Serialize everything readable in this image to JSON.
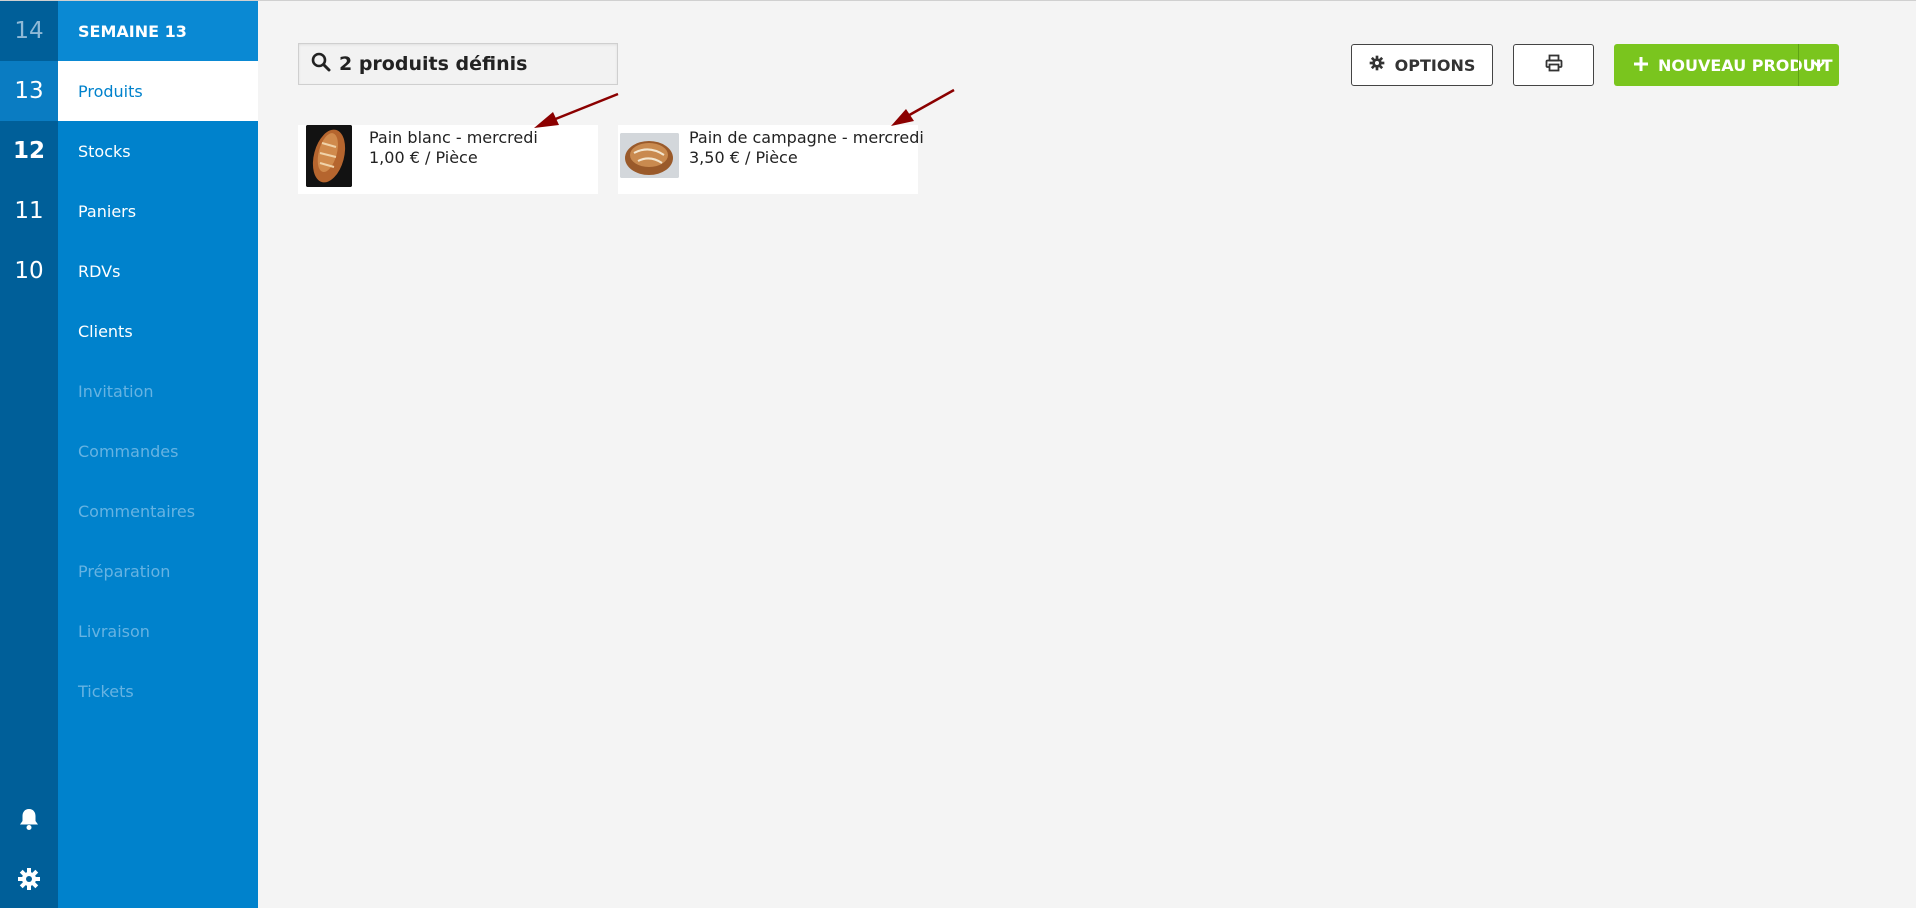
{
  "weeks": [
    {
      "label": "14"
    },
    {
      "label": "13"
    },
    {
      "label": "12"
    },
    {
      "label": "11"
    },
    {
      "label": "10"
    }
  ],
  "sidebar": {
    "header": "SEMAINE 13",
    "items": [
      {
        "label": "Produits"
      },
      {
        "label": "Stocks"
      },
      {
        "label": "Paniers"
      },
      {
        "label": "RDVs"
      },
      {
        "label": "Clients"
      },
      {
        "label": "Invitation"
      },
      {
        "label": "Commandes"
      },
      {
        "label": "Commentaires"
      },
      {
        "label": "Préparation"
      },
      {
        "label": "Livraison"
      },
      {
        "label": "Tickets"
      }
    ]
  },
  "search": {
    "text": "2 produits définis"
  },
  "toolbar": {
    "options_label": "OPTIONS",
    "new_product_label": "NOUVEAU PRODUIT"
  },
  "products": [
    {
      "name": "Pain blanc - mercredi",
      "price": "1,00 € / Pièce"
    },
    {
      "name": "Pain de campagne - mercredi",
      "price": "3,50 € / Pièce"
    }
  ],
  "colors": {
    "rail": "#005f99",
    "sidebar": "#0082cc",
    "accent_green": "#7ac51e",
    "annotation_arrow": "#8b0000"
  }
}
